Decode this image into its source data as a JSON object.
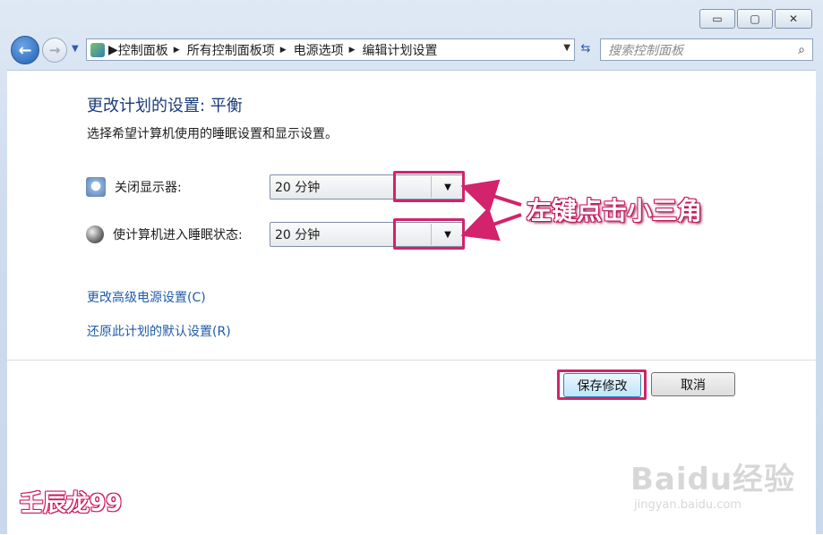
{
  "window": {
    "minimize_label": "▭",
    "maximize_label": "▢",
    "close_label": "✕"
  },
  "nav": {
    "back_label": "←",
    "forward_label": "→"
  },
  "address": {
    "crumbs": [
      "控制面板",
      "所有控制面板项",
      "电源选项",
      "编辑计划设置"
    ],
    "search_placeholder": "搜索控制面板"
  },
  "page": {
    "title": "更改计划的设置: 平衡",
    "subtitle": "选择希望计算机使用的睡眠设置和显示设置。"
  },
  "settings": [
    {
      "label": "关闭显示器:",
      "value": "20 分钟",
      "icon": "monitor-icon"
    },
    {
      "label": "使计算机进入睡眠状态:",
      "value": "20 分钟",
      "icon": "moon-icon"
    }
  ],
  "links": {
    "advanced": "更改高级电源设置(C)",
    "restore": "还原此计划的默认设置(R)"
  },
  "buttons": {
    "save": "保存修改",
    "cancel": "取消"
  },
  "annotation": {
    "text": "左键点击小三角",
    "color": "#d2236c"
  },
  "watermark": {
    "left": "壬辰龙99",
    "brand": "Baidu经验",
    "url": "jingyan.baidu.com"
  }
}
